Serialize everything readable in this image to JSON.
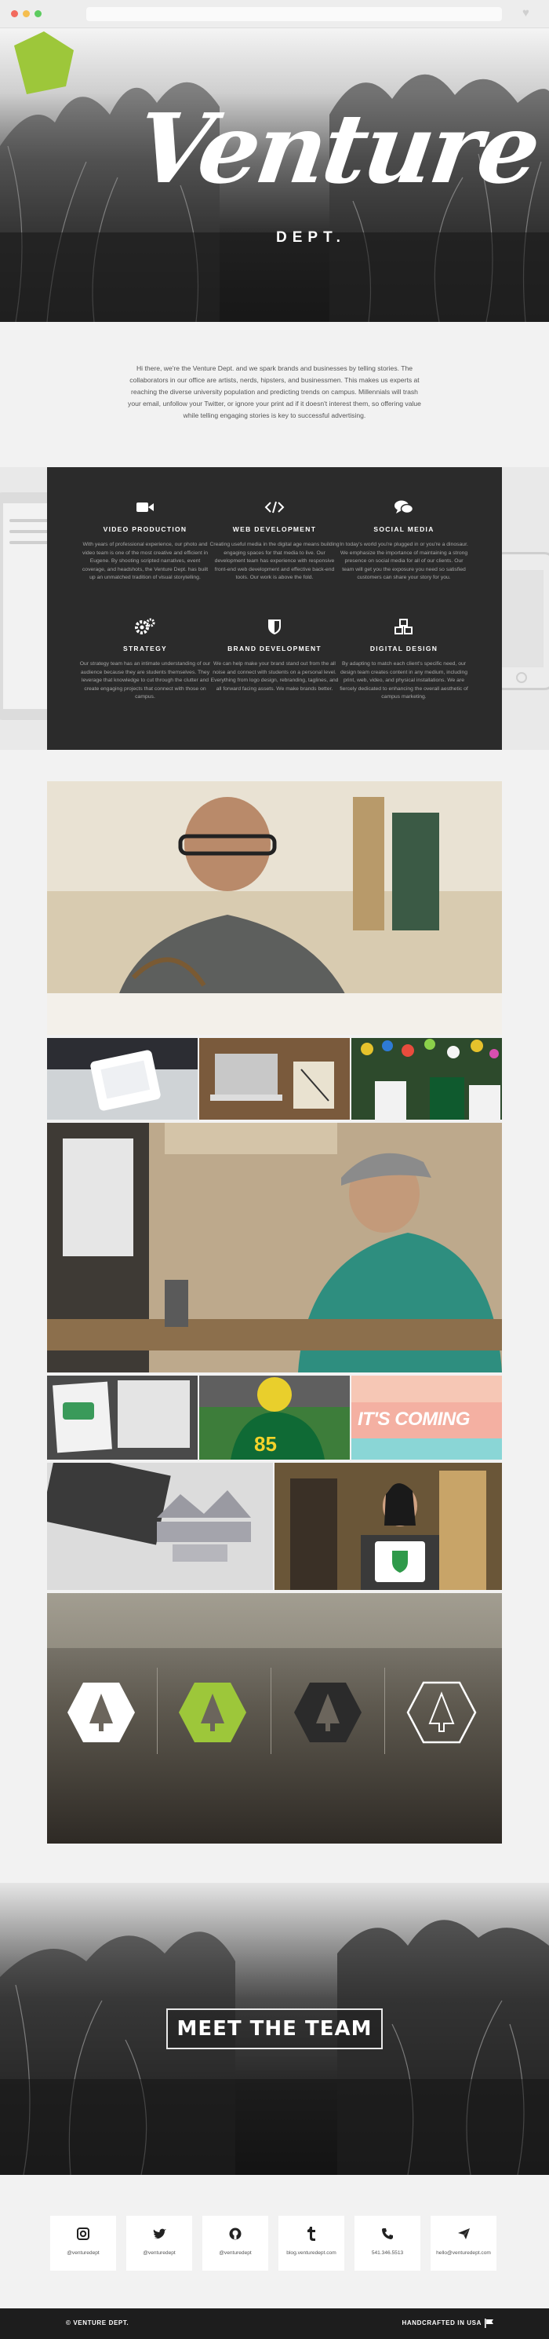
{
  "brand": {
    "name": "Venture",
    "dept": "DEPT.",
    "accent": "#9dc73a",
    "dark": "#2b2b2b"
  },
  "intro": {
    "text": "Hi there, we're the Venture Dept. and we spark brands and businesses by telling stories. The collaborators in our office are artists, nerds, hipsters, and businessmen. This makes us experts at reaching the diverse university population and predicting trends on campus. Millennials will trash your email, unfollow your Twitter, or ignore your print ad if it doesn't interest them, so offering value while telling engaging stories is key to successful advertising."
  },
  "services": [
    {
      "icon": "video-camera-icon",
      "title": "VIDEO PRODUCTION",
      "text": "With years of professional experience, our photo and video team is one of the most creative and efficient in Eugene. By shooting scripted narratives, event coverage, and headshots, the Venture Dept. has built up an unmatched tradition of visual storytelling."
    },
    {
      "icon": "code-icon",
      "title": "WEB DEVELOPMENT",
      "text": "Creating useful media in the digital age means building engaging spaces for that media to live. Our development team has experience with responsive front-end web development and effective back-end tools. Our work is above the fold."
    },
    {
      "icon": "speech-bubbles-icon",
      "title": "SOCIAL MEDIA",
      "text": "In today's world you're plugged in or you're a dinosaur. We emphasize the importance of maintaining a strong presence on social media for all of our clients. Our team will get you the exposure you need so satisfied customers can share your story for you."
    },
    {
      "icon": "gears-icon",
      "title": "STRATEGY",
      "text": "Our strategy team has an intimate understanding of our audience because they are students themselves. They leverage that knowledge to cut through the clutter and create engaging projects that connect with those on campus."
    },
    {
      "icon": "shield-icon",
      "title": "BRAND DEVELOPMENT",
      "text": "We can help make your brand stand out from the all noise and connect with students on a personal level. Everything from logo design, rebranding, taglines, and all forward facing assets. We make brands better."
    },
    {
      "icon": "cubes-icon",
      "title": "DIGITAL DESIGN",
      "text": "By adapting to match each client's specific need, our design team creates content in any medium, including print, web, video, and physical installations. We are fiercely dedicated to enhancing the overall aesthetic of campus marketing."
    }
  ],
  "gallery": {
    "coming_text": "IT'S COMING"
  },
  "team": {
    "button_label": "MEET THE TEAM"
  },
  "contacts": [
    {
      "icon": "instagram-icon",
      "label": "@venturedept"
    },
    {
      "icon": "twitter-icon",
      "label": "@venturedept"
    },
    {
      "icon": "github-icon",
      "label": "@venturedept"
    },
    {
      "icon": "tumblr-icon",
      "label": "blog.venturedept.com"
    },
    {
      "icon": "phone-icon",
      "label": "541.346.5513"
    },
    {
      "icon": "paper-plane-icon",
      "label": "hello@venturedept.com"
    }
  ],
  "footer": {
    "copyright": "© VENTURE DEPT.",
    "made": "HANDCRAFTED IN USA"
  }
}
